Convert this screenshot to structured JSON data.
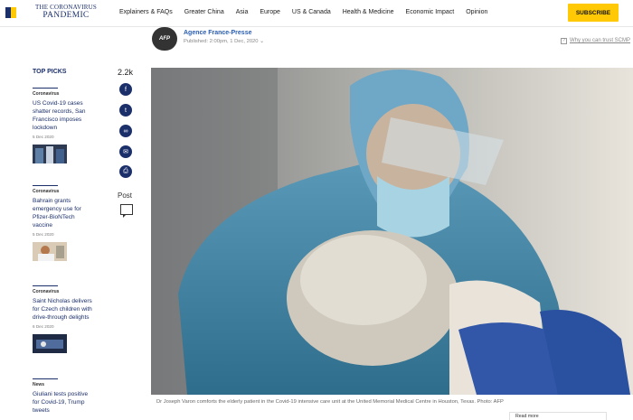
{
  "header": {
    "logo": {
      "line1": "THE CORONAVIRUS",
      "line2": "PANDEMIC"
    },
    "nav": [
      "Explainers & FAQs",
      "Greater China",
      "Asia",
      "Europe",
      "US & Canada",
      "Health & Medicine",
      "Economic Impact",
      "Opinion"
    ],
    "subscribe_label": "SUBSCRIBE",
    "colors": {
      "brand": "#1b2f6b",
      "accent": "#ffca05"
    }
  },
  "byline": {
    "logo_text": "AFP",
    "author": "Agence France-Presse",
    "published": "Published: 2:00pm, 1 Dec, 2020",
    "why_trust": "Why you can trust SCMP"
  },
  "top_picks": {
    "title": "TOP PICKS",
    "items": [
      {
        "category": "Coronavirus",
        "headline": "US Covid-19 cases shatter records, San Francisco imposes lockdown",
        "date": "5 Dec 2020"
      },
      {
        "category": "Coronavirus",
        "headline": "Bahrain grants emergency use for Pfizer-BioNTech vaccine",
        "date": "5 Dec 2020"
      },
      {
        "category": "Coronavirus",
        "headline": "Saint Nicholas delivers for Czech children with drive-through delights",
        "date": "6 Dec 2020"
      },
      {
        "category": "News",
        "headline": "Giuliani tests positive for Covid-19, Trump tweets",
        "date": ""
      }
    ]
  },
  "share": {
    "count": "2.2k",
    "buttons": [
      "facebook-icon",
      "twitter-icon",
      "link-icon",
      "email-icon",
      "print-icon"
    ],
    "post_label": "Post"
  },
  "article": {
    "caption": "Dr Joseph Varon comforts the elderly patient in the Covid-19 intensive care unit at the United Memorial Medical Centre in Houston, Texas. Photo: AFP",
    "read_more": "Read more"
  }
}
